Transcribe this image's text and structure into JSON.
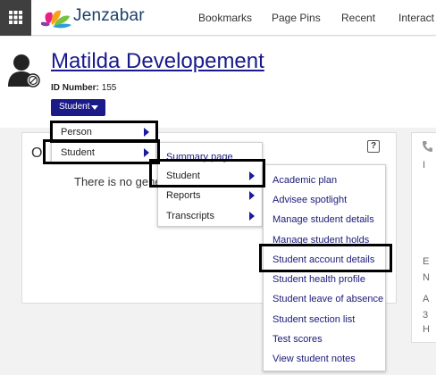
{
  "topbar": {
    "logo_text": "Jenzabar",
    "nav": [
      "Bookmarks",
      "Page Pins",
      "Recent",
      "Interact"
    ]
  },
  "header": {
    "person_name": "Matilda Developement",
    "id_label": "ID Number:",
    "id_value": "155",
    "role_button": "Student"
  },
  "card": {
    "initial_letter": "O",
    "text": "There is no gene",
    "help": "?"
  },
  "side_card": {
    "letters": [
      "I",
      "E",
      "N",
      "A",
      "3",
      "H"
    ]
  },
  "menu1": {
    "items": [
      {
        "label": "Person",
        "has_submenu": true
      },
      {
        "label": "Student",
        "has_submenu": true
      }
    ]
  },
  "menu2": {
    "items": [
      {
        "label": "Summary page",
        "has_submenu": false
      },
      {
        "label": "Student",
        "has_submenu": true
      },
      {
        "label": "Reports",
        "has_submenu": true
      },
      {
        "label": "Transcripts",
        "has_submenu": true
      }
    ]
  },
  "menu3": {
    "items": [
      {
        "label": "Academic plan"
      },
      {
        "label": "Advisee spotlight"
      },
      {
        "label": "Manage student details"
      },
      {
        "label": "Manage student holds"
      },
      {
        "label": "Student account details"
      },
      {
        "label": "Student health profile"
      },
      {
        "label": "Student leave of absence"
      },
      {
        "label": "Student section list"
      },
      {
        "label": "Test scores"
      },
      {
        "label": "View student notes"
      }
    ]
  },
  "colors": {
    "accent": "#1a1a88",
    "topbar_grid": "#3f3f3f",
    "link": "#19198c"
  }
}
